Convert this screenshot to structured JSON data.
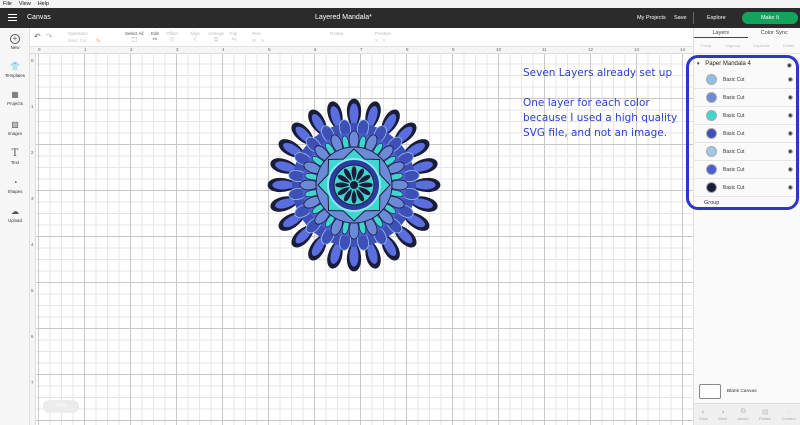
{
  "menubar": [
    "File",
    "View",
    "Help"
  ],
  "header": {
    "app_title": "Canvas",
    "project_title": "Layered Mandala*",
    "my_projects": "My Projects",
    "save": "Save",
    "explore": "Explore",
    "make_it": "Make It"
  },
  "toolbar": {
    "undo_icon": "undo-icon",
    "redo_icon": "redo-icon",
    "operation": {
      "label": "Operation",
      "value": "Basic Cut"
    },
    "select_all": "Select All",
    "edit": "Edit",
    "offset": "Offset",
    "align": "Align",
    "arrange": "Arrange",
    "flip": "Flip",
    "size": "Size",
    "rotate": "Rotate",
    "position": "Position"
  },
  "sidebar": {
    "items": [
      {
        "label": "New",
        "icon": "plus-icon"
      },
      {
        "label": "Templates",
        "icon": "shirt-icon"
      },
      {
        "label": "Projects",
        "icon": "projects-icon"
      },
      {
        "label": "Images",
        "icon": "image-icon"
      },
      {
        "label": "Text",
        "icon": "text-icon"
      },
      {
        "label": "Shapes",
        "icon": "shapes-icon"
      },
      {
        "label": "Upload",
        "icon": "upload-icon"
      }
    ]
  },
  "ruler": {
    "top": [
      "0",
      "1",
      "2",
      "3",
      "4",
      "5",
      "6",
      "7",
      "8",
      "9",
      "10",
      "11",
      "12",
      "13",
      "14"
    ],
    "left": [
      "0",
      "1",
      "2",
      "3",
      "4",
      "5",
      "6",
      "7"
    ]
  },
  "canvas": {
    "annotation_line1": "Seven Layers already set up",
    "annotation_line2": "One layer for each color because I used a high quality SVG file, and not an image.",
    "zoom": "75%"
  },
  "panel": {
    "tabs": [
      "Layers",
      "Color Sync"
    ],
    "layer_tools": [
      "Group",
      "Ungroup",
      "Duplicate",
      "Delete"
    ],
    "group_name": "Paper Mandala 4",
    "layers": [
      {
        "name": "Basic Cut",
        "color": "#8fbfe6"
      },
      {
        "name": "Basic Cut",
        "color": "#6d8ad8"
      },
      {
        "name": "Basic Cut",
        "color": "#3fd6d0"
      },
      {
        "name": "Basic Cut",
        "color": "#3f4fb8"
      },
      {
        "name": "Basic Cut",
        "color": "#9fc7e8"
      },
      {
        "name": "Basic Cut",
        "color": "#4c5fd0"
      },
      {
        "name": "Basic Cut",
        "color": "#1a1d3a"
      }
    ],
    "next_group": "Group",
    "blank_canvas": "Blank Canvas",
    "bottom_tools": [
      "Slice",
      "Weld",
      "Attach",
      "Flatten",
      "Contour"
    ]
  },
  "colors": {
    "topbar": "#2b2b2b",
    "make_it": "#14a35b",
    "annotation": "#2a3fd0",
    "highlight": "#2e35c9"
  }
}
